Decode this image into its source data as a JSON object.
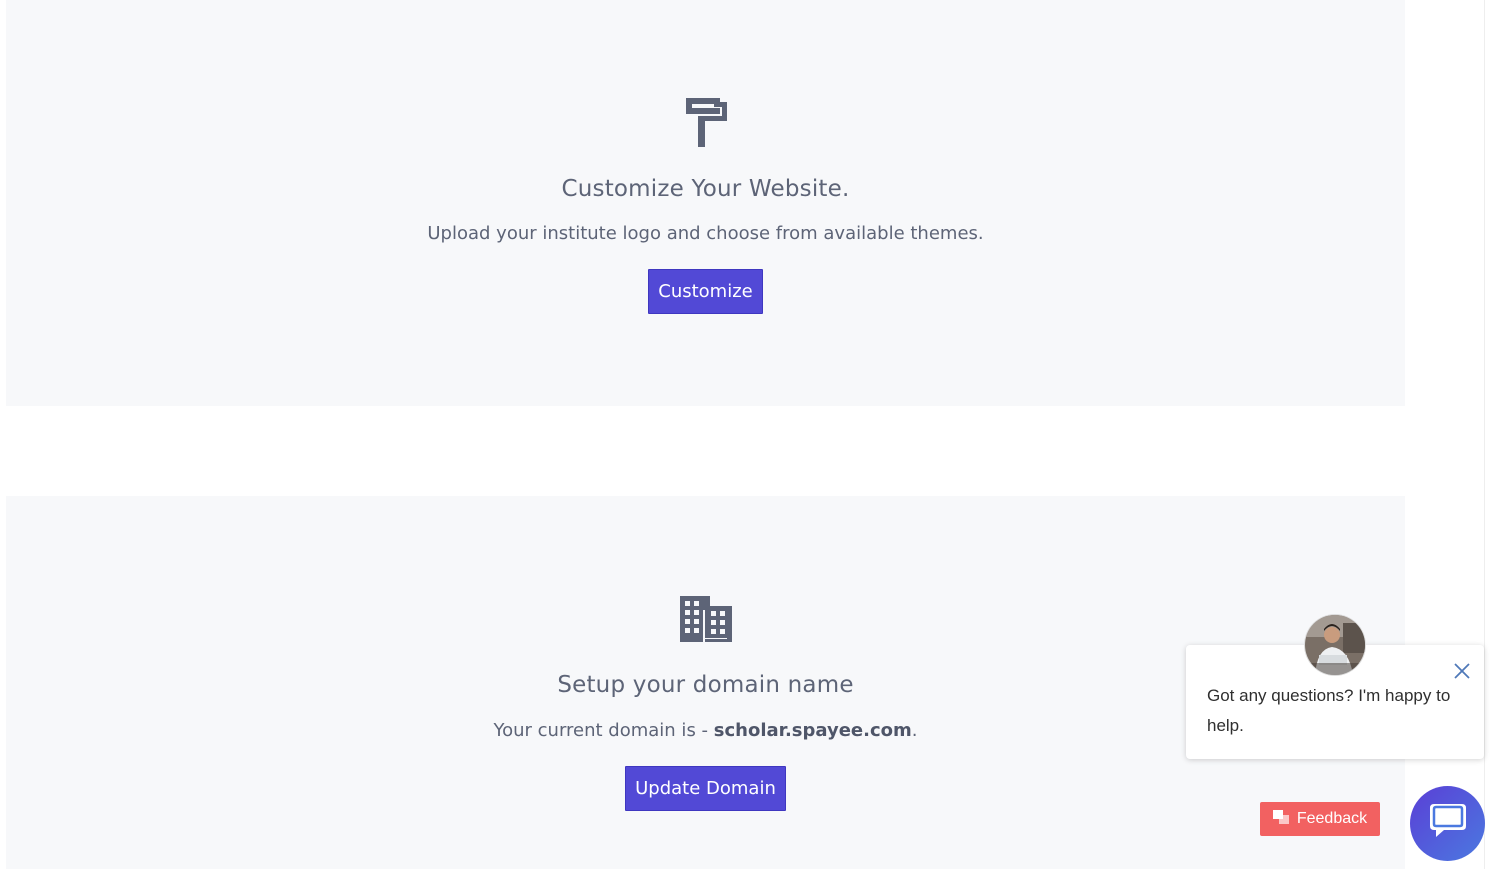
{
  "customize_card": {
    "icon": "paint-roller-icon",
    "title": "Customize Your Website.",
    "description": "Upload your institute logo and choose from available themes.",
    "button_label": "Customize"
  },
  "domain_card": {
    "icon": "building-icon",
    "title": "Setup your domain name",
    "description_prefix": "Your current domain is - ",
    "domain": "scholar.spayee.com",
    "description_suffix": ".",
    "button_label": "Update Domain"
  },
  "chat_widget": {
    "message": "Got any questions? I'm happy to help.",
    "close_icon": "close-icon",
    "avatar": "agent-avatar"
  },
  "feedback": {
    "label": "Feedback",
    "icon": "feedback-icon"
  },
  "colors": {
    "card_bg": "#f7f8fa",
    "text": "#5d6477",
    "primary_button": "#5249d6",
    "feedback_button": "#f26161",
    "chat_launcher": "#5a3fd6"
  }
}
